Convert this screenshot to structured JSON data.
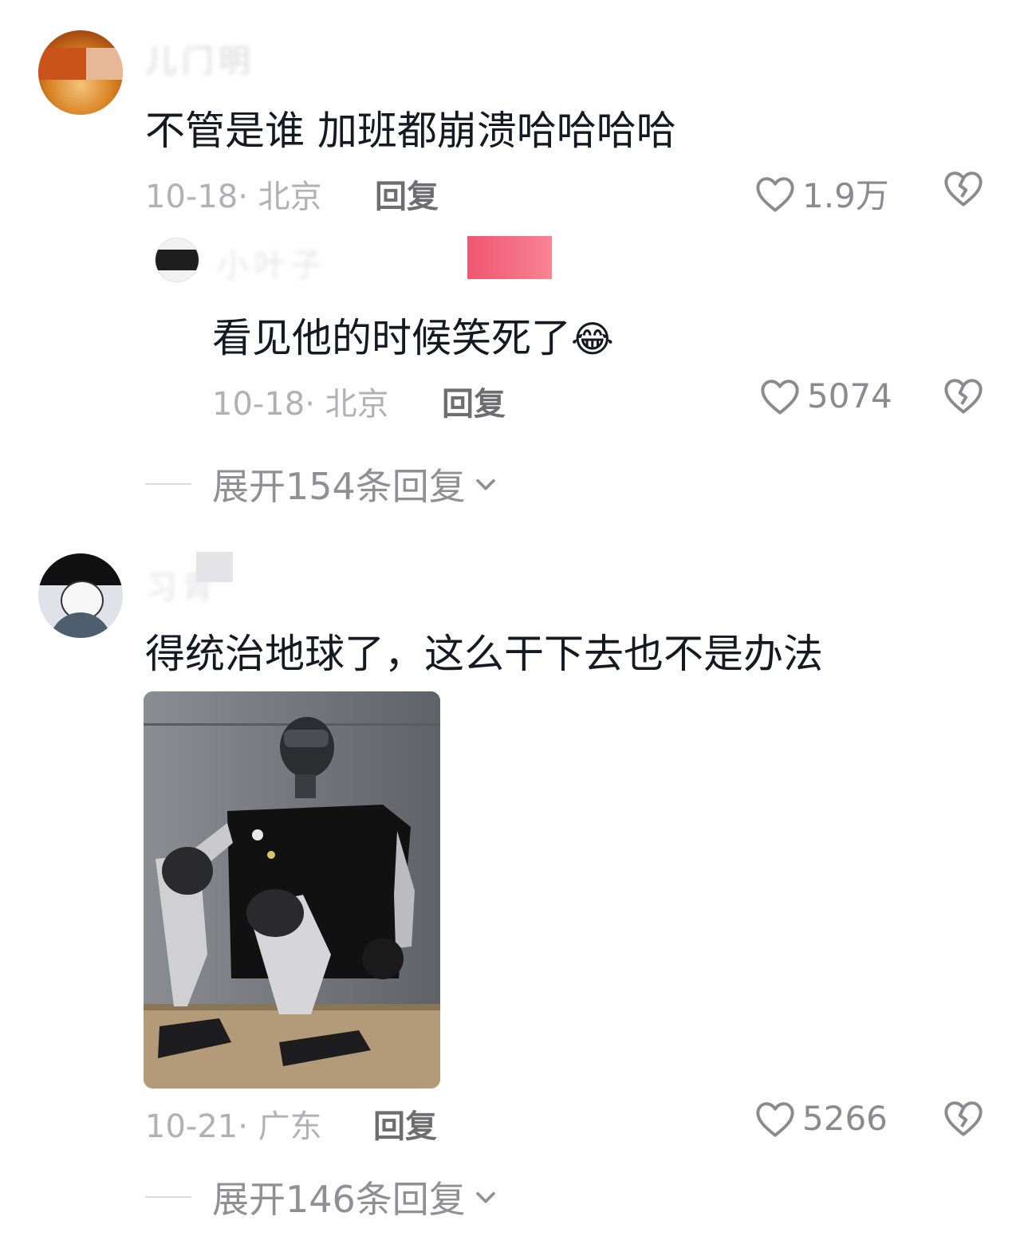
{
  "comments": [
    {
      "username": "儿门明",
      "text": "不管是谁 加班都崩溃哈哈哈哈",
      "date": "10-18",
      "location": "北京",
      "reply_label": "回复",
      "likes": "1.9万",
      "replies": [
        {
          "username": "小叶子",
          "text": "看见他的时候笑死了",
          "emoji": "😂",
          "date": "10-18",
          "location": "北京",
          "reply_label": "回复",
          "likes": "5074"
        }
      ],
      "expand_label": "展开154条回复"
    },
    {
      "username": "习青",
      "text": "得统治地球了，这么干下去也不是办法",
      "has_image": true,
      "date": "10-21",
      "location": "广东",
      "reply_label": "回复",
      "likes": "5266",
      "expand_label": "展开146条回复"
    }
  ],
  "icons": {
    "like": "heart-outline-icon",
    "dislike": "broken-heart-icon",
    "expand": "chevron-down-icon"
  },
  "colors": {
    "text": "#161823",
    "meta": "#b0b0b6",
    "reply": "#6d6d72",
    "redact_pink": "#f0607a"
  }
}
